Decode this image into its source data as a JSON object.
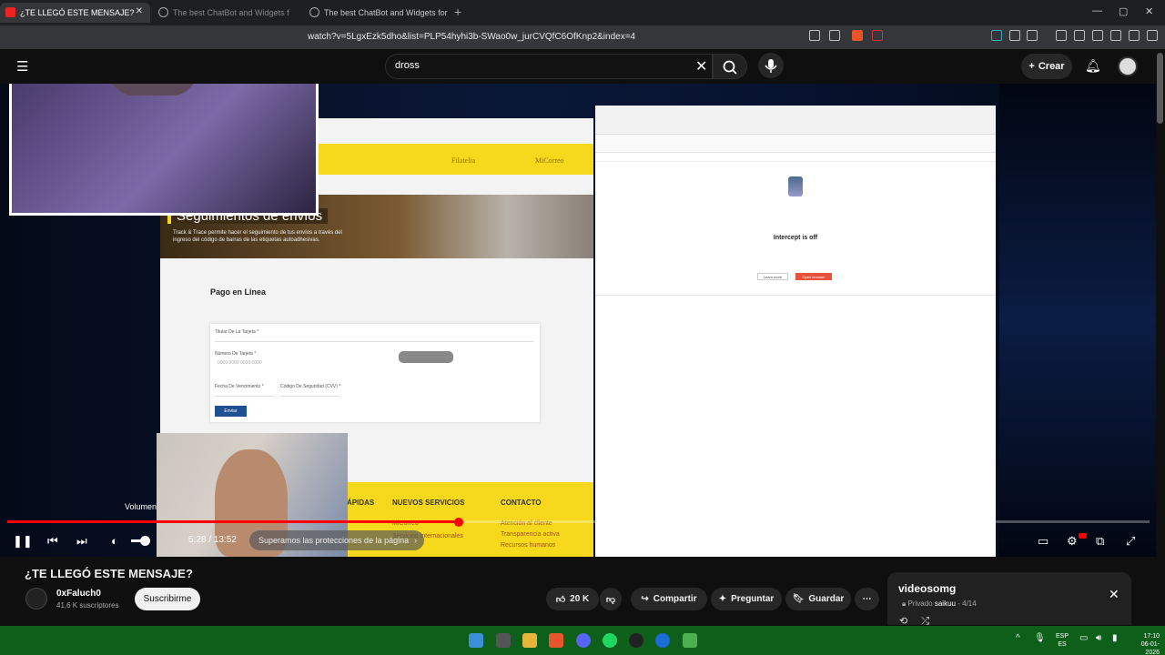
{
  "browser": {
    "tabs": [
      {
        "label": "¿TE LLEGÓ ESTE MENSAJE?",
        "active": true
      },
      {
        "label": "The best ChatBot and Widgets for Ki",
        "active": false
      },
      {
        "label": "The best ChatBot and Widgets for Ki",
        "active": false
      }
    ],
    "url": "watch?v=5LgxEzk5dho&list=PLP54hyhi3b-SWao0w_jurCVQfC6OfKnp2&index=4"
  },
  "youtube": {
    "search_value": "dross",
    "create_label": "Crear"
  },
  "video": {
    "site": {
      "nav": [
        "Filatelia",
        "MiCorreo"
      ],
      "banner_title": "Seguimientos de envíos",
      "banner_sub": "Track & Trace permite hacer el seguimiento de tus envíos a través del ingreso del código de barras de las etiquetas autoadhesivas.",
      "pago_title": "Pago en Linea",
      "form_labels": [
        "Titular De La Tarjeta *",
        "Número De Tarjeta *",
        "Fecha De Vencimiento *",
        "Código De Seguridad (CVV) *"
      ],
      "card_placeholder": "0000 0000 0000 0000",
      "enviar": "Enviar",
      "footer_heads": [
        "ÁPIDAS",
        "NUEVOS SERVICIOS",
        "CONTACTO"
      ],
      "footer_items": [
        "MiCorreo",
        "Servicios Internacionales",
        "Atención al cliente",
        "Transparencia activa",
        "Recursos humanos"
      ]
    },
    "burp": {
      "intercept_title": "Intercept is off",
      "learn_more": "Learn more",
      "open_browser": "Open browser"
    }
  },
  "player": {
    "volume_tooltip": "Volumen",
    "time": "5:28 / 13:52",
    "progress_fraction": 0.395,
    "chapter": "Superamos las protecciones de la página"
  },
  "meta": {
    "title": "¿TE LLEGÓ ESTE MENSAJE?",
    "channel": "0xFaluch0",
    "subscribers": "41,6 K suscriptores",
    "subscribe_label": "Suscribirme",
    "likes": "20 K",
    "share_label": "Compartir",
    "ask_label": "Preguntar",
    "save_label": "Guardar"
  },
  "playlist": {
    "title": "videosomg",
    "privacy": "Privado",
    "owner": "saikuu",
    "position": "4/14"
  },
  "taskbar": {
    "lang_top": "ESP",
    "lang_bottom": "ES",
    "time": "17:10",
    "date": "06-01-2026"
  }
}
